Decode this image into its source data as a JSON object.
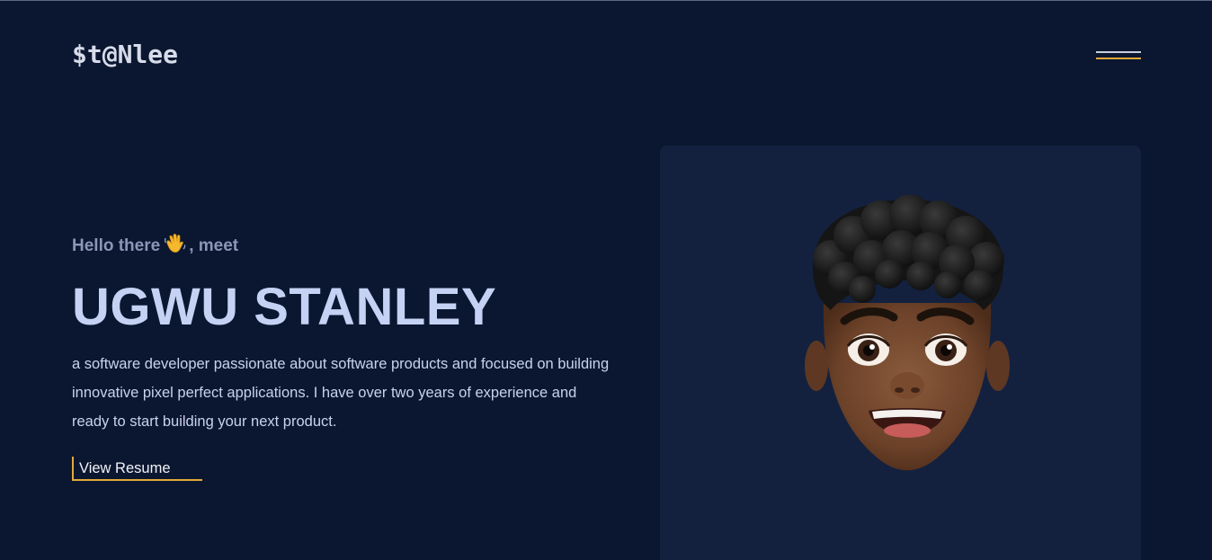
{
  "header": {
    "logo_text": "$t@Nlee",
    "menu_icon": "hamburger-menu-icon"
  },
  "hero": {
    "greeting_before": "Hello there",
    "greeting_icon": "waving-hand-icon",
    "greeting_after": ", meet",
    "name": "UGWU STANLEY",
    "description": "a software developer passionate about software products and focused on building innovative pixel perfect applications. I have over two years of experience and ready to start building your next product.",
    "resume_label": "View Resume"
  },
  "colors": {
    "background": "#0b1730",
    "card": "#13213f",
    "accent": "#e2a93a",
    "heading": "#c5d2f4",
    "muted": "#8b96b8"
  }
}
